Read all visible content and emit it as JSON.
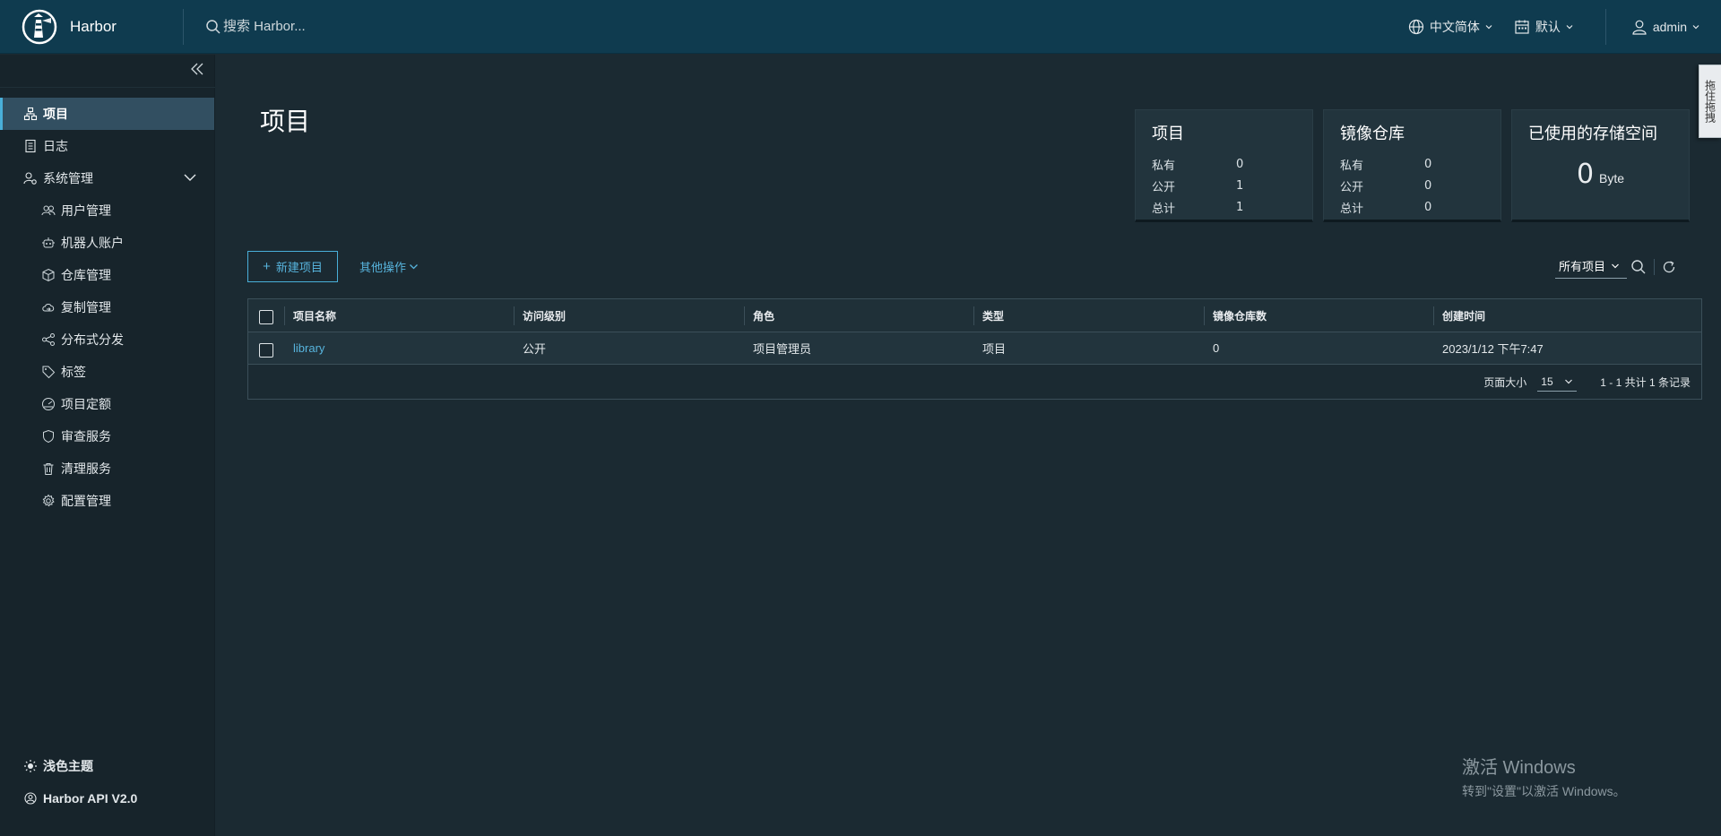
{
  "header": {
    "brand": "Harbor",
    "search_placeholder": "搜索 Harbor...",
    "language": "中文简体",
    "theme_mode": "默认",
    "user": "admin"
  },
  "sidebar": {
    "items": [
      {
        "label": "项目",
        "icon": "projects-icon",
        "active": true
      },
      {
        "label": "日志",
        "icon": "logs-icon"
      },
      {
        "label": "系统管理",
        "icon": "admin-icon",
        "expanded": true
      }
    ],
    "sub_items": [
      {
        "label": "用户管理",
        "icon": "users-icon"
      },
      {
        "label": "机器人账户",
        "icon": "robot-icon"
      },
      {
        "label": "仓库管理",
        "icon": "registry-icon"
      },
      {
        "label": "复制管理",
        "icon": "replication-icon"
      },
      {
        "label": "分布式分发",
        "icon": "distribution-icon"
      },
      {
        "label": "标签",
        "icon": "tag-icon"
      },
      {
        "label": "项目定额",
        "icon": "quota-icon"
      },
      {
        "label": "审查服务",
        "icon": "shield-icon"
      },
      {
        "label": "清理服务",
        "icon": "trash-icon"
      },
      {
        "label": "配置管理",
        "icon": "gear-icon"
      }
    ],
    "footer": {
      "theme": "浅色主题",
      "api": "Harbor API V2.0"
    }
  },
  "main": {
    "title": "项目",
    "cards": {
      "projects": {
        "title": "项目",
        "private_label": "私有",
        "private": "0",
        "public_label": "公开",
        "public": "1",
        "total_label": "总计",
        "total": "1"
      },
      "repos": {
        "title": "镜像仓库",
        "private_label": "私有",
        "private": "0",
        "public_label": "公开",
        "public": "0",
        "total_label": "总计",
        "total": "0"
      },
      "storage": {
        "title": "已使用的存储空间",
        "value": "0",
        "unit": "Byte"
      }
    },
    "new_project_label": "新建项目",
    "more_actions_label": "其他操作",
    "filter_label": "所有项目",
    "table": {
      "columns": [
        "项目名称",
        "访问级别",
        "角色",
        "类型",
        "镜像仓库数",
        "创建时间"
      ],
      "rows": [
        {
          "name": "library",
          "access": "公开",
          "role": "项目管理员",
          "type": "项目",
          "repo_count": "0",
          "created": "2023/1/12 下午7:47"
        }
      ],
      "footer": {
        "page_size_label": "页面大小",
        "page_size": "15",
        "summary": "1 - 1 共计 1 条记录"
      }
    }
  },
  "side_tab": "拖住拖拽",
  "watermark": {
    "line1": "激活 Windows",
    "line2": "转到\"设置\"以激活 Windows。"
  }
}
